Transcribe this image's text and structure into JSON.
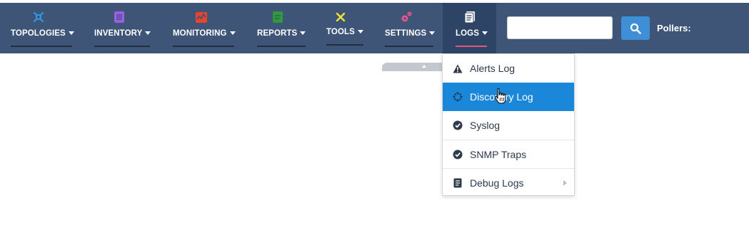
{
  "nav": {
    "items": [
      {
        "label": "TOPOLOGIES",
        "icon": "topology-icon",
        "color": "#2f9ae8"
      },
      {
        "label": "INVENTORY",
        "icon": "inventory-icon",
        "color": "#9b5de5"
      },
      {
        "label": "MONITORING",
        "icon": "monitoring-icon",
        "color": "#e8452c"
      },
      {
        "label": "REPORTS",
        "icon": "reports-icon",
        "color": "#2e9a3a"
      },
      {
        "label": "TOOLS",
        "icon": "tools-icon",
        "color": "#f2e236"
      },
      {
        "label": "SETTINGS",
        "icon": "settings-icon",
        "color": "#e8548a"
      },
      {
        "label": "LOGS",
        "icon": "logs-icon",
        "color": "#ffffff"
      }
    ],
    "active": "LOGS"
  },
  "search": {
    "value": "",
    "placeholder": ""
  },
  "pollers_label": "Pollers:",
  "logs_menu": {
    "items": [
      {
        "label": "Alerts Log",
        "icon": "warning-icon"
      },
      {
        "label": "Discovery Log",
        "icon": "discovery-icon",
        "highlighted": true
      },
      {
        "label": "Syslog",
        "icon": "check-circle-icon"
      },
      {
        "label": "SNMP Traps",
        "icon": "check-circle-icon"
      },
      {
        "label": "Debug Logs",
        "icon": "document-icon",
        "has_submenu": true
      }
    ]
  },
  "colors": {
    "navbar": "#3f5578",
    "active_tab": "#2e4467",
    "active_underline": "#e05a78",
    "menu_highlight": "#1b87d8",
    "search_button": "#3f8fd6"
  }
}
